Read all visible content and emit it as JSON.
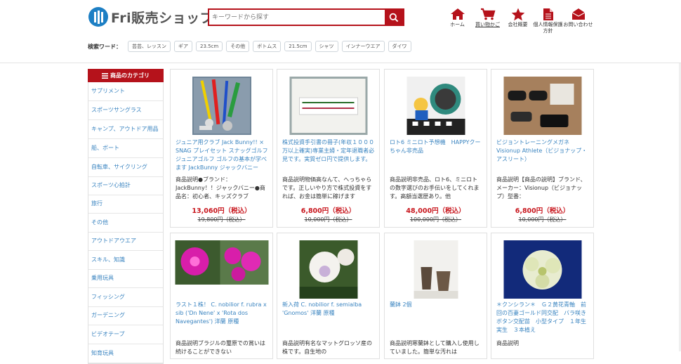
{
  "logo": {
    "text": "Fri販売ショップ"
  },
  "search": {
    "placeholder": "キーワードから探す"
  },
  "nav": [
    {
      "icon": "home-icon",
      "label": "ホーム"
    },
    {
      "icon": "cart-icon",
      "label": "買い物かご"
    },
    {
      "icon": "star-icon",
      "label": "会社概要"
    },
    {
      "icon": "document-icon",
      "label": "個人情報保護方針"
    },
    {
      "icon": "mail-icon",
      "label": "お問い合わせ"
    }
  ],
  "keywords": {
    "title": "検索ワード：",
    "items": [
      "芸芸、レッスン",
      "ギア",
      "23.5cm",
      "その他",
      "ボトムス",
      "21.5cm",
      "シャツ",
      "インナーウエア",
      "ダイワ"
    ]
  },
  "sidebar": {
    "header": "商品のカテゴリ",
    "items": [
      "サプリメント",
      "スポーツサングラス",
      "キャンプ、アウトドア用品",
      "船、ボート",
      "自転車、サイクリング",
      "スポーツ心拍計",
      "旅行",
      "その他",
      "アウトドアウエア",
      "スキル、知識",
      "乗用玩具",
      "フィッシング",
      "ガーデニング",
      "ビデオテープ",
      "知育玩具"
    ]
  },
  "products": [
    {
      "title": "ジュニア用クラブ Jack Bunny!! × SNAG プレイセット スナッグゴルフ ジュニアゴルフ ゴルフの基本が学べます JackBunny ジャックバニー",
      "desc": "商品説明●ブランド：JackBunny！！ジャックバニー●商品名：初心者、キッズクラブ",
      "price": "13,060円（税込）",
      "old_price": "19,800円（税込）"
    },
    {
      "title": "株式投資手引書の冊子(年収１０００万以上確実)専業主婦・定年退職者必見です。実質ゼロ円で提供します。",
      "desc": "商品説明物価高なんて、へっちゃらです。正しいやり方で株式投資をすれば、お金は簡単に稼げます",
      "price": "6,800円（税込）",
      "old_price": "10,000円（税込）"
    },
    {
      "title": "ロト6 ミニロト予想機　HAPPYクーちゃん非売品",
      "desc": "商品説明非売品、ロト6、ミニロトの数字選びのお手伝いをしてくれます。高額当選歴あり。他",
      "price": "48,000円（税込）",
      "old_price": "100,000円（税込）"
    },
    {
      "title": "ビジョントレーニングメガネ Visionup Athlete（ビジョナップ・アスリート）",
      "desc": "商品説明【商品の説明】ブランド、メーカー：Visionup（ビジョナップ）型番：",
      "price": "6,800円（税込）",
      "old_price": "10,000円（税込）"
    },
    {
      "title": "ラスト１株！ C. nobilior f. rubra x sib ('Dn Nene' x 'Rota dos Navegantes') 洋蘭 原種",
      "desc": "商品説明ブラジルの璽原での賞いは続けることができない",
      "price": "",
      "old_price": ""
    },
    {
      "title": "新入荷 C. nobilior f. semialba 'Gnomos' 洋蘭 原種",
      "desc": "商品説明有名なマットグロッソ産の株です。自生地の",
      "price": "",
      "old_price": ""
    },
    {
      "title": "蘭鉢 2個",
      "desc": "商品説明寒蘭鉢として購入し使用していました。簡単な汚れは",
      "price": "",
      "old_price": ""
    },
    {
      "title": "＊クンシラン＊　Ｇ２黄花青軸　前回の百妻ゴールド同交配　バラ咲きボタン交配苗　小型タイプ　１年生実生　３本植え",
      "desc": "商品説明",
      "price": "",
      "old_price": ""
    }
  ],
  "colors": {
    "accent": "#b5121b",
    "link": "#3a84c0",
    "price": "#c8161d",
    "logo": "#1d7fc4"
  }
}
